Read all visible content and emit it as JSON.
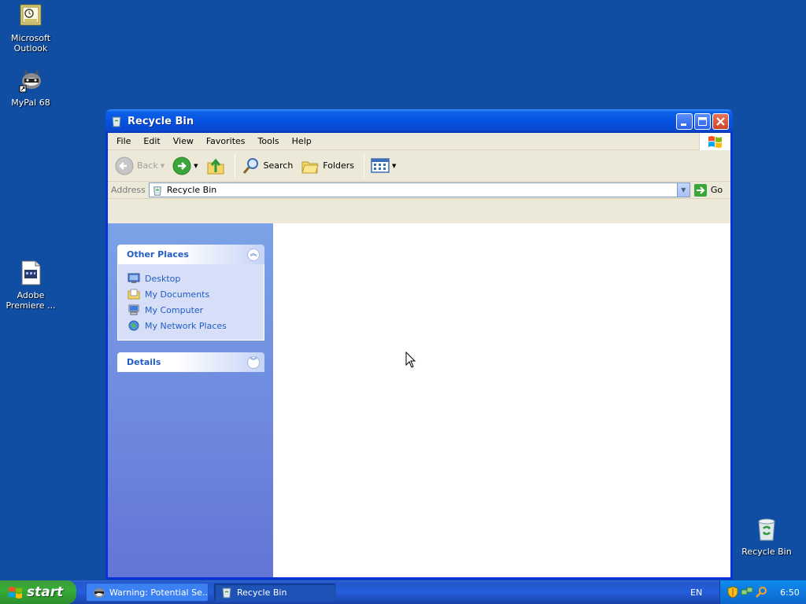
{
  "desktop": {
    "icons": [
      {
        "label": "Microsoft Outlook",
        "icon": "outlook-icon"
      },
      {
        "label": "MyPal 68",
        "icon": "mypal-icon"
      },
      {
        "label": "Adobe Premiere ...",
        "icon": "premiere-file-icon"
      },
      {
        "label": "Recycle Bin",
        "icon": "recycle-bin-icon"
      }
    ],
    "background": "#0f4ea3"
  },
  "window": {
    "title": "Recycle Bin",
    "menu": [
      "File",
      "Edit",
      "View",
      "Favorites",
      "Tools",
      "Help"
    ],
    "toolbar": {
      "back": "Back",
      "search": "Search",
      "folders": "Folders"
    },
    "address": {
      "label": "Address",
      "value": "Recycle Bin",
      "go": "Go"
    },
    "other_places": {
      "title": "Other Places",
      "links": [
        "Desktop",
        "My Documents",
        "My Computer",
        "My Network Places"
      ]
    },
    "details": {
      "title": "Details"
    }
  },
  "taskbar": {
    "start": "start",
    "tasks": [
      {
        "label": "Warning: Potential Se...",
        "active": false
      },
      {
        "label": "Recycle Bin",
        "active": true
      }
    ],
    "language": "EN",
    "clock": "6:50"
  },
  "colors": {
    "accent": "#215dc6",
    "title_blue": "#0553e2",
    "start_green": "#36ac36"
  }
}
